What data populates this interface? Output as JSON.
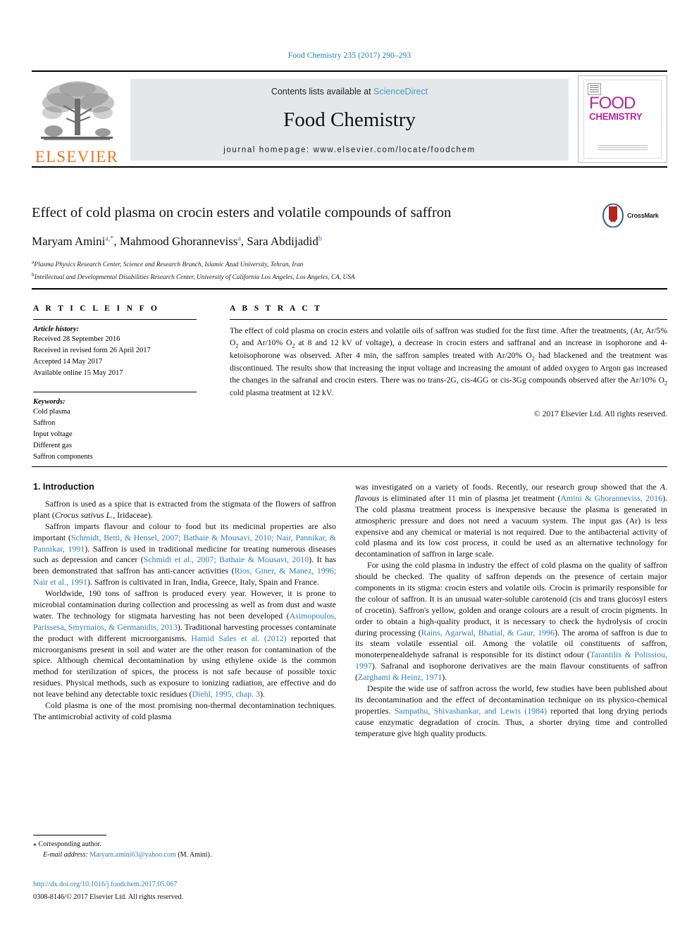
{
  "running_head": "Food Chemistry 235 (2017) 290–293",
  "masthead": {
    "contents_prefix": "Contents lists available at ",
    "sciencedirect": "ScienceDirect",
    "journal_name": "Food Chemistry",
    "homepage": "journal homepage: www.elsevier.com/locate/foodchem",
    "publisher_logo_text": "ELSEVIER",
    "cover_line1": "FOOD",
    "cover_line2": "CHEMISTRY",
    "accent_color": "#3a9fd6",
    "brand_color": "#e87722",
    "cover_color": "#b5289e"
  },
  "article": {
    "title": "Effect of cold plasma on crocin esters and volatile compounds of saffron",
    "crossmark_label": "CrossMark",
    "authors": [
      {
        "name": "Maryam Amini",
        "marks": "a,*"
      },
      {
        "name": "Mahmood Ghoranneviss",
        "marks": "a"
      },
      {
        "name": "Sara Abdijadid",
        "marks": "b"
      }
    ],
    "affiliations": [
      {
        "mark": "a",
        "text": "Plasma Physics Research Center, Science and Research Branch, Islamic Azad University, Tehran, Iran"
      },
      {
        "mark": "b",
        "text": "Intellectual and Developmental Disabilities Research Center, University of California Los Angeles, Los Angeles, CA, USA"
      }
    ]
  },
  "info": {
    "heading": "A R T I C L E   I N F O",
    "history_label": "Article history:",
    "history": [
      "Received 28 September 2016",
      "Received in revised form 26 April 2017",
      "Accepted 14 May 2017",
      "Available online 15 May 2017"
    ],
    "keywords_label": "Keywords:",
    "keywords": [
      "Cold plasma",
      "Saffron",
      "Input voltage",
      "Different gas",
      "Saffron components"
    ]
  },
  "abstract": {
    "heading": "A B S T R A C T",
    "part1": "The effect of cold plasma on crocin esters and volatile oils of saffron was studied for the first time. After the treatments, (Ar, Ar/5% O",
    "part2": " and Ar/10% O",
    "part3": " at 8 and 12 kV of voltage), a decrease in crocin esters and saffranal and an increase in isophorone and 4-ketoisophorone was observed. After 4 min, the saffron samples treated with Ar/20% O",
    "part4": " had blackened and the treatment was discontinued. The results show that increasing the input voltage and increasing the amount of added oxygen to Argon gas increased the changes in the safranal and crocin esters. There was no trans-2G, cis-4GG or cis-3Gg compounds observed after the Ar/10% O",
    "part5": " cold plasma treatment at 12 kV.",
    "sub": "2",
    "copyright": "© 2017 Elsevier Ltd. All rights reserved."
  },
  "body": {
    "section_heading": "1. Introduction",
    "left": {
      "p1_a": "Saffron is used as a spice that is extracted from the stigmata of the flowers of saffron plant (",
      "p1_ital": "Crocus sativus L.",
      "p1_b": ", Iridaceae).",
      "p2_a": "Saffron imparts flavour and colour to food but its medicinal properties are also important (",
      "p2_ref1": "Schmidt, Betti, & Hensel, 2007; Bathaie & Mousavi, 2010; Nair, Pannikar, & Pannikar, 1991",
      "p2_b": "). Saffron is used in traditional medicine for treating numerous diseases such as depression and cancer (",
      "p2_ref2": "Schmidt et al., 2007; Bathaie & Mousavi, 2010",
      "p2_c": "). It has been demonstrated that saffron has anti-cancer activities (",
      "p2_ref3": "Rios, Giner, & Manez, 1996; Nair et al., 1991",
      "p2_d": "). Saffron is cultivated in Iran, India, Greece, Italy, Spain and France.",
      "p3_a": "Worldwide, 190 tons of saffron is produced every year. However, it is prone to microbial contamination during collection and processing as well as from dust and waste water. The technology for stigmata harvesting has not been developed (",
      "p3_ref1": "Asimopoulos, Parissesa, Smyrnaios, & Germanidis, 2013",
      "p3_b": "). Traditional harvesting processes contaminate the product with different microorganisms. ",
      "p3_ref2": "Hamid Sales et al. (2012)",
      "p3_c": " reported that microorganisms present in soil and water are the other reason for contamination of the spice. Although chemical decontamination by using ethylene oxide is the common method for sterilization of spices, the process is not safe because of possible toxic residues. Physical methods, such as exposure to ionizing radiation, are effective and do not leave behind any detectable toxic residues (",
      "p3_ref3": "Diehl, 1995, chap. 3",
      "p3_d": ").",
      "p4": "Cold plasma is one of the most promising non-thermal decontamination techniques. The antimicrobial activity of cold plasma"
    },
    "right": {
      "p4cont_a": "was investigated on a variety of foods. Recently, our research group showed that the ",
      "p4cont_ital1": "A. flavous",
      "p4cont_b": " is eliminated after 11 min of plasma jet treatment (",
      "p4cont_ref": "Amini & Ghoranneviss, 2016",
      "p4cont_c": "). The cold plasma treatment process is inexpensive because the plasma is generated in atmospheric pressure and does not need a vacuum system. The input gas (Ar) is less expensive and any chemical or material is not required. Due to the antibacterial activity of cold plasma and its low cost process, it could be used as an alternative technology for decontamination of saffron in large scale.",
      "p5_a": "For using the cold plasma in industry the effect of cold plasma on the quality of saffron should be checked. The quality of saffron depends on the presence of certain major components in its stigma: crocin esters and volatile oils. Crocin is primarily responsible for the colour of saffron. It is an unusual water-soluble carotenoid (cis and trans glucosyl esters of crocetin). Saffron's yellow, golden and orange colours are a result of crocin pigments. In order to obtain a high-quality product, it is necessary to check the hydrolysis of crocin during processing (",
      "p5_ref1": "Rains, Agarwal, Bhatial, & Gaur, 1996",
      "p5_b": "). The aroma of saffron is due to its steam volatile essential oil. Among the volatile oil constituents of saffron, monoterpenealdehyde safranal is responsible for its distinct odour (",
      "p5_ref2": "Tarantilis & Polissiou, 1997",
      "p5_c": "). Safranal and isophorone derivatives are the main flavour constituents of saffron (",
      "p5_ref3": "Zarghami & Heinz, 1971",
      "p5_d": ").",
      "p6_a": "Despite the wide use of saffron across the world, few studies have been published about its decontamination and the effect of decontamination technique on its physico-chemical properties. ",
      "p6_ref1": "Sampathu, Shivashankar, and Lewis (1984)",
      "p6_b": " reported that long drying periods cause enzymatic degradation of crocin. Thus, a shorter drying time and controlled temperature give high quality products."
    }
  },
  "footer": {
    "corresponding_star": "⁎",
    "corresponding": "Corresponding author.",
    "email_label": "E-mail address:",
    "email": "Maryam.amini63@yahoo.com",
    "email_suffix": "(M. Amini).",
    "doi": "http://dx.doi.org/10.1016/j.foodchem.2017.05.067",
    "issn": "0308-8146/© 2017 Elsevier Ltd. All rights reserved."
  }
}
